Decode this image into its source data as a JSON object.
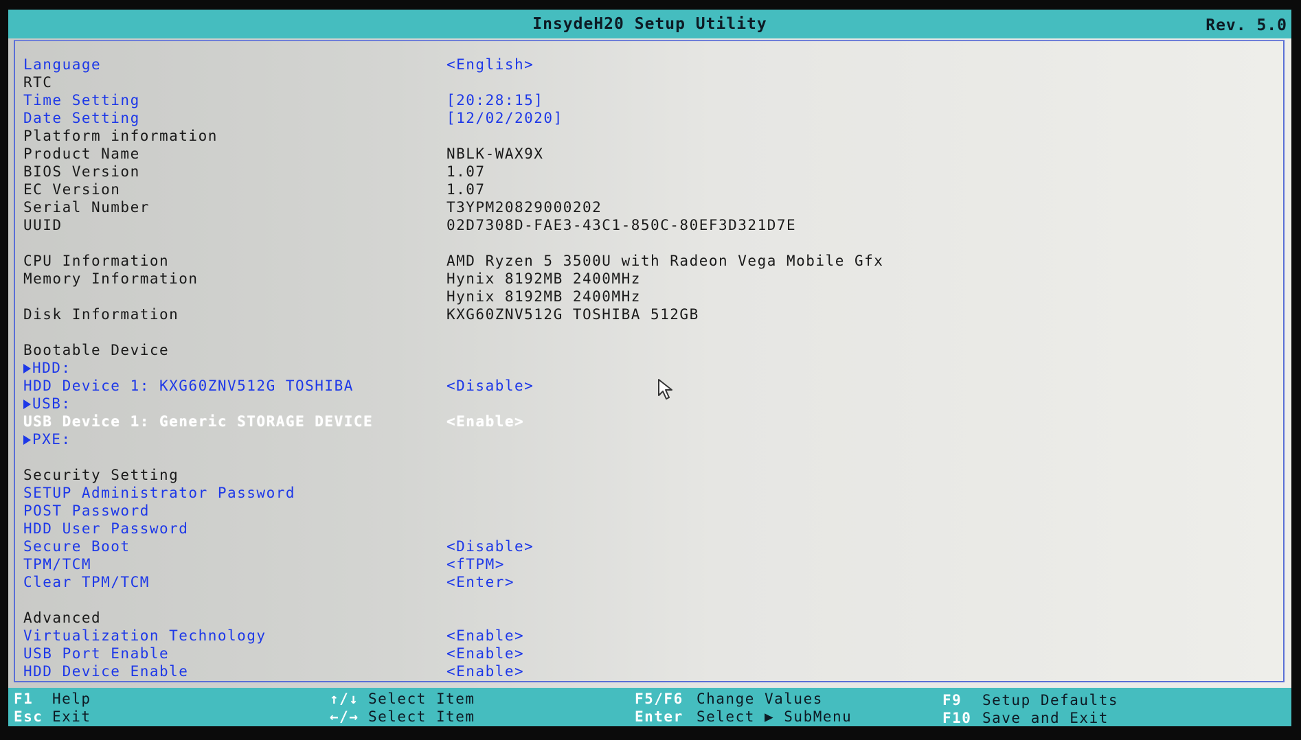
{
  "titlebar": {
    "title": "InsydeH20 Setup Utility",
    "rev": "Rev. 5.0"
  },
  "rows": [
    {
      "label": "Language",
      "value": "<English>",
      "label_style": "blue",
      "value_style": "blue"
    },
    {
      "label": "RTC",
      "value": "",
      "label_style": "black",
      "value_style": "black"
    },
    {
      "label": "Time Setting",
      "value": "[20:28:15]",
      "label_style": "blue",
      "value_style": "blue"
    },
    {
      "label": "Date Setting",
      "value": "[12/02/2020]",
      "label_style": "blue",
      "value_style": "blue"
    },
    {
      "label": "Platform information",
      "value": "",
      "label_style": "black",
      "value_style": "black"
    },
    {
      "label": "Product Name",
      "value": "NBLK-WAX9X",
      "label_style": "black",
      "value_style": "black"
    },
    {
      "label": "BIOS Version",
      "value": "1.07",
      "label_style": "black",
      "value_style": "black"
    },
    {
      "label": "EC Version",
      "value": "1.07",
      "label_style": "black",
      "value_style": "black"
    },
    {
      "label": "Serial Number",
      "value": "T3YPM20829000202",
      "label_style": "black",
      "value_style": "black"
    },
    {
      "label": "UUID",
      "value": "02D7308D-FAE3-43C1-850C-80EF3D321D7E",
      "label_style": "black",
      "value_style": "black"
    },
    {
      "label": "",
      "value": "",
      "label_style": "black",
      "value_style": "black"
    },
    {
      "label": "CPU Information",
      "value": "AMD Ryzen 5 3500U with Radeon Vega Mobile Gfx",
      "label_style": "black",
      "value_style": "black"
    },
    {
      "label": "Memory Information",
      "value": "Hynix 8192MB 2400MHz",
      "label_style": "black",
      "value_style": "black"
    },
    {
      "label": "",
      "value": "Hynix 8192MB 2400MHz",
      "label_style": "black",
      "value_style": "black"
    },
    {
      "label": "Disk Information",
      "value": "KXG60ZNV512G TOSHIBA 512GB",
      "label_style": "black",
      "value_style": "black"
    },
    {
      "label": "",
      "value": "",
      "label_style": "black",
      "value_style": "black"
    },
    {
      "label": "Bootable Device",
      "value": "",
      "label_style": "black",
      "value_style": "black"
    },
    {
      "label": "HDD:",
      "value": "",
      "label_style": "blue",
      "value_style": "blue",
      "arrow": true
    },
    {
      "label": "HDD Device 1: KXG60ZNV512G TOSHIBA",
      "value": "<Disable>",
      "label_style": "blue",
      "value_style": "blue"
    },
    {
      "label": "USB:",
      "value": "",
      "label_style": "blue",
      "value_style": "blue",
      "arrow": true
    },
    {
      "label": "USB Device 1: Generic STORAGE DEVICE",
      "value": "<Enable>",
      "label_style": "white",
      "value_style": "valwhite"
    },
    {
      "label": "PXE:",
      "value": "",
      "label_style": "blue",
      "value_style": "blue",
      "arrow": true
    },
    {
      "label": "",
      "value": "",
      "label_style": "black",
      "value_style": "black"
    },
    {
      "label": "Security Setting",
      "value": "",
      "label_style": "black",
      "value_style": "black"
    },
    {
      "label": "SETUP Administrator Password",
      "value": "",
      "label_style": "blue",
      "value_style": "blue"
    },
    {
      "label": "POST Password",
      "value": "",
      "label_style": "blue",
      "value_style": "blue"
    },
    {
      "label": "HDD User Password",
      "value": "",
      "label_style": "blue",
      "value_style": "blue"
    },
    {
      "label": "Secure Boot",
      "value": "<Disable>",
      "label_style": "blue",
      "value_style": "blue"
    },
    {
      "label": "TPM/TCM",
      "value": "<fTPM>",
      "label_style": "blue",
      "value_style": "blue"
    },
    {
      "label": "Clear TPM/TCM",
      "value": "<Enter>",
      "label_style": "blue",
      "value_style": "blue"
    },
    {
      "label": "",
      "value": "",
      "label_style": "black",
      "value_style": "black"
    },
    {
      "label": "Advanced",
      "value": "",
      "label_style": "black",
      "value_style": "black"
    },
    {
      "label": "Virtualization Technology",
      "value": "<Enable>",
      "label_style": "blue",
      "value_style": "blue"
    },
    {
      "label": "USB Port Enable",
      "value": "<Enable>",
      "label_style": "blue",
      "value_style": "blue"
    },
    {
      "label": "HDD Device Enable",
      "value": "<Enable>",
      "label_style": "blue",
      "value_style": "blue"
    }
  ],
  "footer": {
    "f1_key": "F1",
    "f1_desc": "Help",
    "esc_key": "Esc",
    "esc_desc": "Exit",
    "updown_key": "↑/↓",
    "updown_desc": "Select Item",
    "leftright_key": "←/→",
    "leftright_desc": "Select Item",
    "f5f6_key": "F5/F6",
    "f5f6_desc": "Change Values",
    "enter_key": "Enter",
    "enter_desc": "Select ▶ SubMenu",
    "f9_key": "F9",
    "f9_desc": "Setup Defaults",
    "f10_key": "F10",
    "f10_desc": "Save and Exit"
  },
  "colors": {
    "bar": "#45bdbf",
    "panel": "#d4d5d2",
    "label_blue": "#1d38e8",
    "text_black": "#1a1a1a",
    "highlight": "#ffffff"
  }
}
